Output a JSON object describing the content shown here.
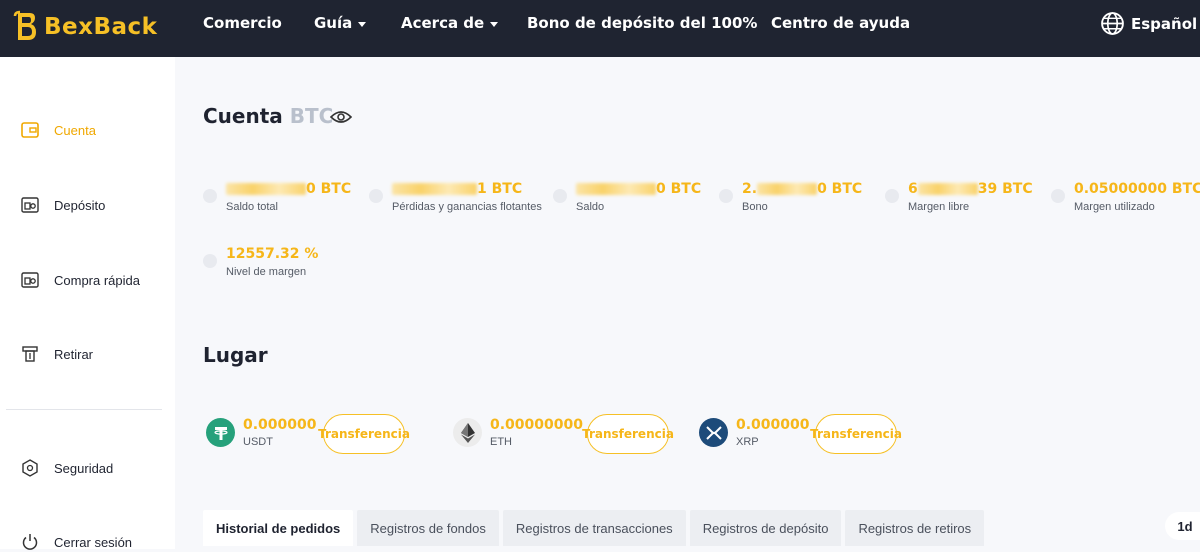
{
  "brand": {
    "name": "BexBack"
  },
  "nav": {
    "items": [
      {
        "label": "Comercio"
      },
      {
        "label": "Guía"
      },
      {
        "label": "Acerca de"
      },
      {
        "label": "Bono de depósito del 100%"
      },
      {
        "label": "Centro de ayuda"
      }
    ],
    "language": "Español"
  },
  "sidebar": {
    "items": [
      {
        "label": "Cuenta",
        "icon": "wallet-icon"
      },
      {
        "label": "Depósito",
        "icon": "deposit-icon"
      },
      {
        "label": "Compra rápida",
        "icon": "quick-buy-icon"
      },
      {
        "label": "Retirar",
        "icon": "withdraw-icon"
      },
      {
        "label": "Seguridad",
        "icon": "security-icon"
      },
      {
        "label": "Cerrar sesión",
        "icon": "power-icon"
      }
    ]
  },
  "account": {
    "title": "Cuenta",
    "currency": "BTC",
    "stats": [
      {
        "value_prefix": "",
        "value_suffix": "0 BTC",
        "label": "Saldo total"
      },
      {
        "value_prefix": "",
        "value_suffix": "1 BTC",
        "label": "Pérdidas y ganancias flotantes"
      },
      {
        "value_prefix": "",
        "value_suffix": "0 BTC",
        "label": "Saldo"
      },
      {
        "value_prefix": "2.",
        "value_suffix": "0 BTC",
        "label": "Bono"
      },
      {
        "value_prefix": "6",
        "value_suffix": "39 BTC",
        "label": "Margen libre"
      },
      {
        "value_prefix": "0.05000000 BTC",
        "value_suffix": "",
        "label": "Margen utilizado"
      },
      {
        "value_prefix": "12557.32 %",
        "value_suffix": "",
        "label": "Nivel de margen"
      }
    ]
  },
  "spot": {
    "title": "Lugar",
    "coins": [
      {
        "value": "0.000000",
        "symbol": "USDT",
        "button": "Transferencia",
        "color": "#26a17b"
      },
      {
        "value": "0.00000000",
        "symbol": "ETH",
        "button": "Transferencia",
        "color": "#ececec"
      },
      {
        "value": "0.000000",
        "symbol": "XRP",
        "button": "Transferencia",
        "color": "#23292f"
      }
    ]
  },
  "tabs": [
    {
      "label": "Historial de pedidos"
    },
    {
      "label": "Registros de fondos"
    },
    {
      "label": "Registros de transacciones"
    },
    {
      "label": "Registros de depósito"
    },
    {
      "label": "Registros de retiros"
    }
  ],
  "period": "1d",
  "colors": {
    "accent": "#f6b619",
    "nav_bg": "#1f2431"
  }
}
